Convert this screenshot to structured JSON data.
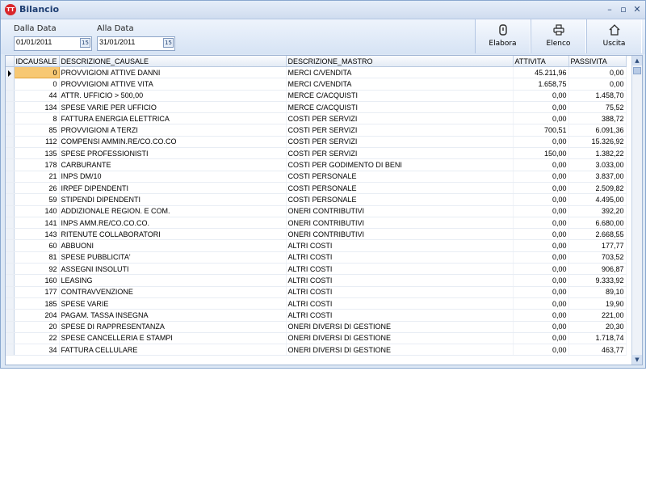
{
  "window": {
    "title": "Bilancio",
    "app_icon_text": "TT",
    "controls": {
      "minimize": "–",
      "restore": "▫",
      "close": "✕"
    }
  },
  "filters": {
    "from_label": "Dalla Data",
    "from_value": "01/01/2011",
    "to_label": "Alla Data",
    "to_value": "31/01/2011",
    "calendar_glyph": "15"
  },
  "toolbar": {
    "elabora": "Elabora",
    "elenco": "Elenco",
    "uscita": "Uscita"
  },
  "grid": {
    "columns": [
      "IDCAUSALE",
      "DESCRIZIONE_CAUSALE",
      "DESCRIZIONE_MASTRO",
      "ATTIVITA",
      "PASSIVITA"
    ],
    "rows": [
      {
        "id": "0",
        "causale": "PROVVIGIONI ATTIVE DANNI",
        "mastro": "MERCI C/VENDITA",
        "attivita": "45.211,96",
        "passivita": "0,00"
      },
      {
        "id": "0",
        "causale": "PROVVIGIONI ATTIVE VITA",
        "mastro": "MERCI C/VENDITA",
        "attivita": "1.658,75",
        "passivita": "0,00"
      },
      {
        "id": "44",
        "causale": "ATTR. UFFICIO > 500,00",
        "mastro": "MERCE C/ACQUISTI",
        "attivita": "0,00",
        "passivita": "1.458,70"
      },
      {
        "id": "134",
        "causale": "SPESE VARIE PER UFFICIO",
        "mastro": "MERCE C/ACQUISTI",
        "attivita": "0,00",
        "passivita": "75,52"
      },
      {
        "id": "8",
        "causale": "FATTURA ENERGIA ELETTRICA",
        "mastro": "COSTI PER SERVIZI",
        "attivita": "0,00",
        "passivita": "388,72"
      },
      {
        "id": "85",
        "causale": "PROVVIGIONI A TERZI",
        "mastro": "COSTI PER SERVIZI",
        "attivita": "700,51",
        "passivita": "6.091,36"
      },
      {
        "id": "112",
        "causale": "COMPENSI AMMIN.RE/CO.CO.CO",
        "mastro": "COSTI PER SERVIZI",
        "attivita": "0,00",
        "passivita": "15.326,92"
      },
      {
        "id": "135",
        "causale": "SPESE PROFESSIONISTI",
        "mastro": "COSTI PER SERVIZI",
        "attivita": "150,00",
        "passivita": "1.382,22"
      },
      {
        "id": "178",
        "causale": "CARBURANTE",
        "mastro": "COSTI PER GODIMENTO DI BENI",
        "attivita": "0,00",
        "passivita": "3.033,00"
      },
      {
        "id": "21",
        "causale": "INPS DM/10",
        "mastro": "COSTI PERSONALE",
        "attivita": "0,00",
        "passivita": "3.837,00"
      },
      {
        "id": "26",
        "causale": "IRPEF DIPENDENTI",
        "mastro": "COSTI PERSONALE",
        "attivita": "0,00",
        "passivita": "2.509,82"
      },
      {
        "id": "59",
        "causale": "STIPENDI DIPENDENTI",
        "mastro": "COSTI PERSONALE",
        "attivita": "0,00",
        "passivita": "4.495,00"
      },
      {
        "id": "140",
        "causale": "ADDIZIONALE REGION. E COM.",
        "mastro": "ONERI CONTRIBUTIVI",
        "attivita": "0,00",
        "passivita": "392,20"
      },
      {
        "id": "141",
        "causale": "INPS AMM.RE/CO.CO.CO.",
        "mastro": "ONERI CONTRIBUTIVI",
        "attivita": "0,00",
        "passivita": "6.680,00"
      },
      {
        "id": "143",
        "causale": "RITENUTE COLLABORATORI",
        "mastro": "ONERI CONTRIBUTIVI",
        "attivita": "0,00",
        "passivita": "2.668,55"
      },
      {
        "id": "60",
        "causale": "ABBUONI",
        "mastro": "ALTRI COSTI",
        "attivita": "0,00",
        "passivita": "177,77"
      },
      {
        "id": "81",
        "causale": "SPESE PUBBLICITA'",
        "mastro": "ALTRI COSTI",
        "attivita": "0,00",
        "passivita": "703,52"
      },
      {
        "id": "92",
        "causale": "ASSEGNI INSOLUTI",
        "mastro": "ALTRI COSTI",
        "attivita": "0,00",
        "passivita": "906,87"
      },
      {
        "id": "160",
        "causale": "LEASING",
        "mastro": "ALTRI COSTI",
        "attivita": "0,00",
        "passivita": "9.333,92"
      },
      {
        "id": "177",
        "causale": "CONTRAVVENZIONE",
        "mastro": "ALTRI COSTI",
        "attivita": "0,00",
        "passivita": "89,10"
      },
      {
        "id": "185",
        "causale": "SPESE VARIE",
        "mastro": "ALTRI COSTI",
        "attivita": "0,00",
        "passivita": "19,90"
      },
      {
        "id": "204",
        "causale": "PAGAM. TASSA INSEGNA",
        "mastro": "ALTRI COSTI",
        "attivita": "0,00",
        "passivita": "221,00"
      },
      {
        "id": "20",
        "causale": "SPESE DI RAPPRESENTANZA",
        "mastro": "ONERI DIVERSI DI GESTIONE",
        "attivita": "0,00",
        "passivita": "20,30"
      },
      {
        "id": "22",
        "causale": "SPESE CANCELLERIA E STAMPI",
        "mastro": "ONERI DIVERSI DI GESTIONE",
        "attivita": "0,00",
        "passivita": "1.718,74"
      },
      {
        "id": "34",
        "causale": "FATTURA CELLULARE",
        "mastro": "ONERI DIVERSI DI GESTIONE",
        "attivita": "0,00",
        "passivita": "463,77"
      }
    ],
    "selected_row": 0
  },
  "scrollbar": {
    "up_glyph": "▲",
    "down_glyph": "▼"
  },
  "colors": {
    "selection": "#f7c873",
    "chrome": "#dde8f5",
    "title_text": "#1e3e72"
  }
}
